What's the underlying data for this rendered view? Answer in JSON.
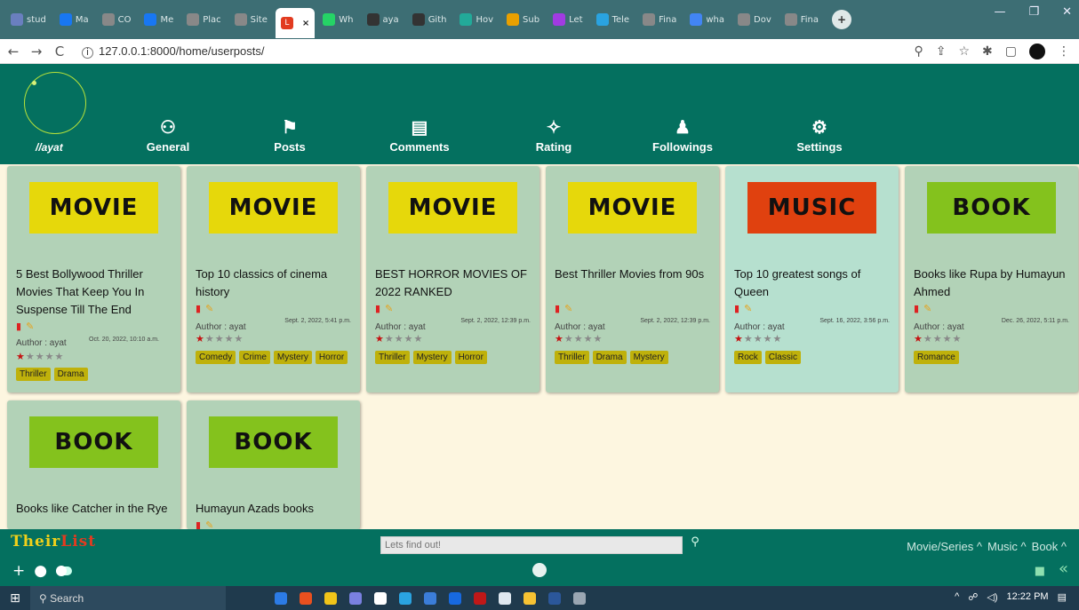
{
  "browser": {
    "tabs": [
      {
        "label": "stud",
        "favicon": "globe",
        "color": "#6a7fbf"
      },
      {
        "label": "Ma",
        "favicon": "facebook",
        "color": "#1877f2"
      },
      {
        "label": "CO",
        "favicon": "globe",
        "color": "#888"
      },
      {
        "label": "Me",
        "favicon": "facebook",
        "color": "#1877f2"
      },
      {
        "label": "Plac",
        "favicon": "globe",
        "color": "#888"
      },
      {
        "label": "Site",
        "favicon": "globe",
        "color": "#888"
      },
      {
        "label": "Wh",
        "favicon": "whatsapp",
        "color": "#25d366"
      },
      {
        "label": "aya",
        "favicon": "github",
        "color": "#333"
      },
      {
        "label": "Gith",
        "favicon": "github",
        "color": "#333"
      },
      {
        "label": "Hov",
        "favicon": "infinity",
        "color": "#2a9"
      },
      {
        "label": "Sub",
        "favicon": "bars",
        "color": "#e9a000"
      },
      {
        "label": "Let",
        "favicon": "play",
        "color": "#a13be2"
      },
      {
        "label": "Tele",
        "favicon": "telegram",
        "color": "#2aa3e0"
      },
      {
        "label": "Fina",
        "favicon": "globe",
        "color": "#888"
      },
      {
        "label": "wha",
        "favicon": "google",
        "color": "#4285f4"
      },
      {
        "label": "Dov",
        "favicon": "download",
        "color": "#888"
      },
      {
        "label": "Fina",
        "favicon": "globe",
        "color": "#888"
      }
    ],
    "active_tab": {
      "label": "",
      "favicon": "their-list",
      "close": "×"
    },
    "url": "127.0.0.1:8000/home/userposts/",
    "new_tab": "+"
  },
  "header": {
    "username": "//ayat",
    "nav": [
      {
        "label": "General",
        "icon": "user-settings-icon"
      },
      {
        "label": "Posts",
        "icon": "signpost-icon"
      },
      {
        "label": "Comments",
        "icon": "comments-icon"
      },
      {
        "label": "Rating",
        "icon": "stars-icon"
      },
      {
        "label": "Followings",
        "icon": "user-plus-icon"
      },
      {
        "label": "Settings",
        "icon": "gear-icon"
      }
    ]
  },
  "posts": [
    {
      "category": "MOVIE",
      "title": "5 Best Bollywood Thriller Movies That Keep You In Suspense Till The End",
      "author": "Author : ayat",
      "date": "Oct. 20, 2022, 10:10 a.m.",
      "rating": 1,
      "tags": [
        "Thriller",
        "Drama"
      ]
    },
    {
      "category": "MOVIE",
      "title": "Top 10 classics of cinema history",
      "author": "Author : ayat",
      "date": "Sept. 2, 2022, 5:41 p.m.",
      "rating": 1,
      "tags": [
        "Comedy",
        "Crime",
        "Mystery",
        "Horror"
      ]
    },
    {
      "category": "MOVIE",
      "title": "BEST HORROR MOVIES OF 2022 RANKED",
      "author": "Author : ayat",
      "date": "Sept. 2, 2022, 12:39 p.m.",
      "rating": 1,
      "tags": [
        "Thriller",
        "Mystery",
        "Horror"
      ]
    },
    {
      "category": "MOVIE",
      "title": "Best Thriller Movies from 90s",
      "author": "Author : ayat",
      "date": "Sept. 2, 2022, 12:39 p.m.",
      "rating": 1,
      "tags": [
        "Thriller",
        "Drama",
        "Mystery"
      ]
    },
    {
      "category": "MUSIC",
      "title": "Top 10 greatest songs of Queen",
      "author": "Author : ayat",
      "date": "Sept. 16, 2022, 3:56 p.m.",
      "rating": 1,
      "tags": [
        "Rock",
        "Classic"
      ]
    },
    {
      "category": "BOOK",
      "title": "Books like Rupa by Humayun Ahmed",
      "author": "Author : ayat",
      "date": "Dec. 26, 2022, 5:11 p.m.",
      "rating": 1,
      "tags": [
        "Romance"
      ]
    },
    {
      "category": "BOOK",
      "title": "Books like Catcher in the Rye",
      "author": "",
      "date": "",
      "rating": 0,
      "tags": []
    },
    {
      "category": "BOOK",
      "title": "Humayun Azads books",
      "author": "",
      "date": "",
      "rating": 0,
      "tags": []
    }
  ],
  "footer": {
    "logo": "TheirList",
    "search_placeholder": "Lets find out!",
    "categories": [
      "Movie/Series ^",
      "Music ^",
      "Book ^"
    ]
  },
  "taskbar": {
    "search": "Search",
    "time": "12:22 PM"
  }
}
